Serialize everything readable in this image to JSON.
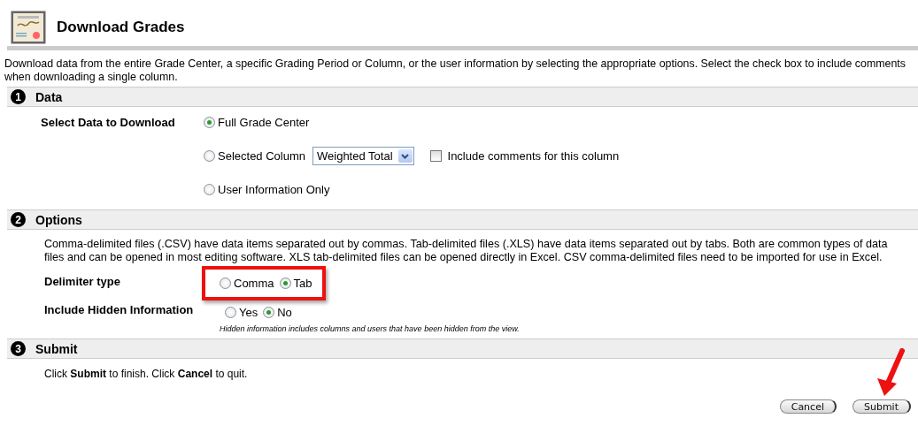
{
  "page": {
    "title": "Download Grades"
  },
  "intro": "Download data from the entire Grade Center, a specific Grading Period or Column, or the user information by selecting the appropriate options. Select the check box to include comments when downloading a single column.",
  "sections": [
    {
      "number": "1",
      "title": "Data",
      "kind": "data",
      "label": "Select Data to Download",
      "options": [
        {
          "label": "Full Grade Center",
          "selected": true
        },
        {
          "label": "Selected Column",
          "selected": false,
          "dropdown": "Weighted Total",
          "checkbox": {
            "label": "Include comments for this column",
            "checked": false
          }
        },
        {
          "label": "User Information Only",
          "selected": false
        }
      ]
    },
    {
      "number": "2",
      "title": "Options",
      "kind": "options",
      "description": "Comma-delimited files (.CSV) have data items separated out by commas. Tab-delimited files (.XLS) have data items separated out by tabs. Both are common types of data files and can be opened in most editing software. XLS tab-delimited files can be opened directly in Excel. CSV comma-delimited files need to be imported for use in Excel.",
      "fields": [
        {
          "label": "Delimiter type",
          "highlighted": true,
          "options": [
            {
              "label": "Comma",
              "selected": false
            },
            {
              "label": "Tab",
              "selected": true
            }
          ]
        },
        {
          "label": "Include Hidden Information",
          "highlighted": false,
          "options": [
            {
              "label": "Yes",
              "selected": false
            },
            {
              "label": "No",
              "selected": true
            }
          ],
          "hint": "Hidden information includes columns and users that have been hidden from the view."
        }
      ]
    },
    {
      "number": "3",
      "title": "Submit",
      "kind": "submit",
      "text": "Click **Submit** to finish. Click **Cancel** to quit."
    }
  ],
  "buttons": [
    {
      "label": "Cancel",
      "kind": "plain"
    },
    {
      "label": "Submit",
      "kind": "arrowed"
    }
  ]
}
